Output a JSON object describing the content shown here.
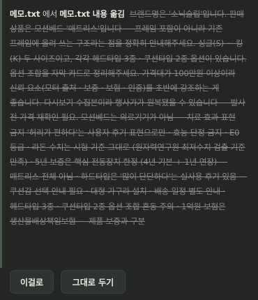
{
  "header": {
    "source_file": "메모.txt",
    "connector": " 에서 ",
    "target_file": "메모.txt",
    "action_label": " 내용 옮김"
  },
  "moved_content": "브랜드명은 '소닉슬립'입니다. 판매 상품은 모션베드 '매트리스'입니다 — 프레임 포함이 아니라 기존 프레임에 올려 쓰는 구조라는 점을 정확히 안내해주세요. 싱글(S) ~ 킹(K) 두 사이즈이고, 각각 헤드타입 3종 · 쿠션타입 2종 옵션이 있습니다. 옵션 조합을 자막 카드로 정리해주세요. 가격대가 100만원 이상이라 신뢰 요소(모터 출처 · 보증 · 보험 · 인증)를 초반에 강조하는 게 좋습니다. 다시보기 수집본이라 행사가가 원복됐을 수 있습니다 — 발사 전 가격 재확인 필요. 모션베드는 의료기기가 아님 — 치료 효과 표현 금지 '허리가 편하다'는 사용자 후기 표현으로만 · 효능 단정 금지 · E0 등급 · 라돈 수치는 시험 기준 그대로 (원자력연구원 최저수치 검출 기준 만족) · 5년 보증은 핵심 전동장치 한정 (4년 기본 + 1년 연장) — 매트리스 전체 아님 · 하드타입은 '많이 단단하다'는 실사용 후기 있음 — 쿠션감 선택 안내 필요 · 대형 가구라 설치 · 배송 일정 별도 안내 · 헤드타입 3종 · 쿠션타입 2종 옵션 조합 혼동 주의 · 1억원 보험은 생산물배상책임보험 — 제품 보증과 구분",
  "buttons": {
    "primary": "이걸로",
    "secondary": "그대로 두기"
  }
}
